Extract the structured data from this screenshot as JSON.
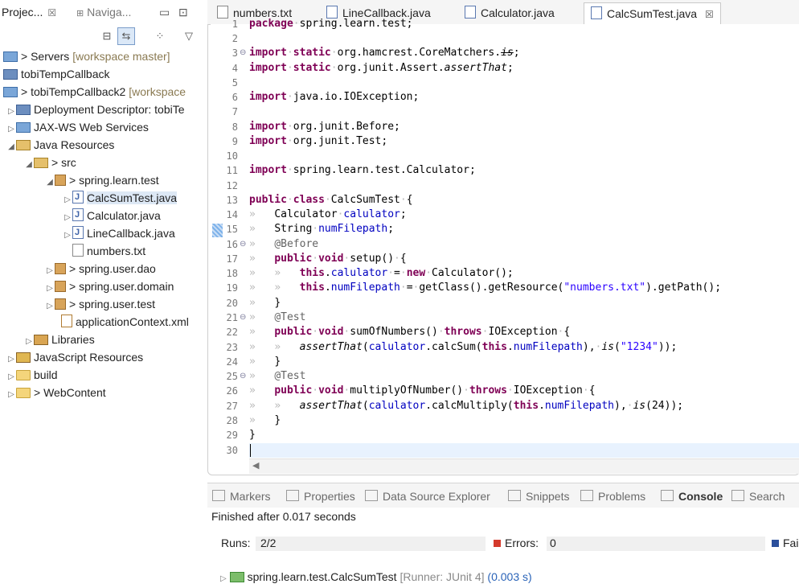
{
  "explorer": {
    "tab_project": "Projec...",
    "tab_navigator": "Naviga...",
    "rows": [
      {
        "label": "> Servers",
        "extra": "[workspace master]"
      },
      {
        "label": "tobiTempCallback",
        "extra": ""
      },
      {
        "label": "> tobiTempCallback2",
        "extra": "[workspace"
      },
      {
        "label": "Deployment Descriptor: tobiTe",
        "extra": ""
      },
      {
        "label": "JAX-WS Web Services",
        "extra": ""
      },
      {
        "label": "Java Resources",
        "extra": ""
      },
      {
        "label": "> src",
        "extra": ""
      },
      {
        "label": "> spring.learn.test",
        "extra": ""
      },
      {
        "label": "CalcSumTest.java",
        "extra": ""
      },
      {
        "label": "Calculator.java",
        "extra": ""
      },
      {
        "label": "LineCallback.java",
        "extra": ""
      },
      {
        "label": "numbers.txt",
        "extra": ""
      },
      {
        "label": "> spring.user.dao",
        "extra": ""
      },
      {
        "label": "> spring.user.domain",
        "extra": ""
      },
      {
        "label": "> spring.user.test",
        "extra": ""
      },
      {
        "label": "applicationContext.xml",
        "extra": ""
      },
      {
        "label": "Libraries",
        "extra": ""
      },
      {
        "label": "JavaScript Resources",
        "extra": ""
      },
      {
        "label": "build",
        "extra": ""
      },
      {
        "label": "> WebContent",
        "extra": ""
      }
    ]
  },
  "editor": {
    "tabs": [
      {
        "label": "numbers.txt"
      },
      {
        "label": "LineCallback.java"
      },
      {
        "label": "Calculator.java"
      },
      {
        "label": "CalcSumTest.java"
      }
    ],
    "lines": [
      "package spring.learn.test;",
      "",
      "import static org.hamcrest.CoreMatchers.is;",
      "import static org.junit.Assert.assertThat;",
      "",
      "import java.io.IOException;",
      "",
      "import org.junit.Before;",
      "import org.junit.Test;",
      "",
      "import spring.learn.test.Calculator;",
      "",
      "public class CalcSumTest {",
      "Calculator calulator;",
      "String numFilepath;",
      "@Before",
      "public void setup() {",
      "this.calulator = new Calculator();",
      "this.numFilepath = getClass().getResource(\"numbers.txt\").getPath();",
      "}",
      "@Test",
      "public void sumOfNumbers() throws IOException {",
      "assertThat(calulator.calcSum(this.numFilepath), is(\"1234\"));",
      "}",
      "@Test",
      "public void multiplyOfNumber() throws IOException {",
      "assertThat(calulator.calcMultiply(this.numFilepath), is(24));",
      "}",
      "}",
      ""
    ],
    "line_numbers": [
      "1",
      "2",
      "3",
      "4",
      "5",
      "6",
      "7",
      "8",
      "9",
      "10",
      "11",
      "12",
      "13",
      "14",
      "15",
      "16",
      "17",
      "18",
      "19",
      "20",
      "21",
      "22",
      "23",
      "24",
      "25",
      "26",
      "27",
      "28",
      "29",
      "30"
    ]
  },
  "panel": {
    "tabs": [
      {
        "label": "Markers"
      },
      {
        "label": "Properties"
      },
      {
        "label": "Data Source Explorer"
      },
      {
        "label": "Snippets"
      },
      {
        "label": "Problems"
      },
      {
        "label": "Console"
      },
      {
        "label": "Search"
      }
    ],
    "finished": "Finished after 0.017 seconds",
    "runs_label": "Runs:",
    "runs_value": "2/2",
    "errors_label": "Errors:",
    "errors_value": "0",
    "failures_label": "Fai",
    "result_name": "spring.learn.test.CalcSumTest",
    "result_runner": "[Runner: JUnit 4]",
    "result_time": "(0.003 s)"
  }
}
